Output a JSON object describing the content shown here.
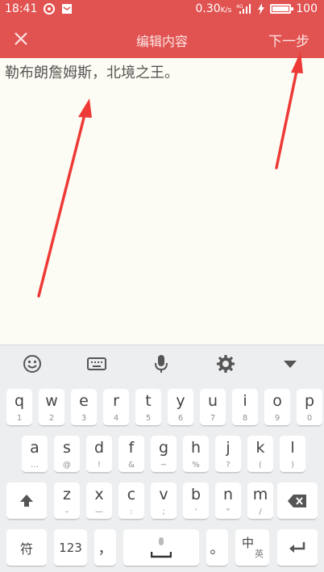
{
  "status_bar": {
    "time": "18:41",
    "network_speed": "0.30",
    "network_unit": "K/s",
    "signal_label": "4G",
    "battery": "100",
    "battery_level": 1.0
  },
  "header": {
    "close_icon": "close-icon",
    "title": "编辑内容",
    "next_label": "下一步",
    "background": "#e15351"
  },
  "editor": {
    "content": "勒布朗詹姆斯，北境之王。"
  },
  "annotations": {
    "arrow_color": "#ee3a36"
  },
  "keyboard": {
    "toolbar": [
      "emoji-icon",
      "keyboard-icon",
      "microphone-icon",
      "gear-icon",
      "collapse-icon"
    ],
    "row1": [
      {
        "main": "q",
        "sub": "1"
      },
      {
        "main": "w",
        "sub": "2"
      },
      {
        "main": "e",
        "sub": "3"
      },
      {
        "main": "r",
        "sub": "4"
      },
      {
        "main": "t",
        "sub": "5"
      },
      {
        "main": "y",
        "sub": "6"
      },
      {
        "main": "u",
        "sub": "7"
      },
      {
        "main": "i",
        "sub": "8"
      },
      {
        "main": "o",
        "sub": "9"
      },
      {
        "main": "p",
        "sub": "0"
      }
    ],
    "row2": [
      {
        "main": "a",
        "sub": "…"
      },
      {
        "main": "s",
        "sub": "@"
      },
      {
        "main": "d",
        "sub": "!"
      },
      {
        "main": "f",
        "sub": "&"
      },
      {
        "main": "g",
        "sub": "~"
      },
      {
        "main": "h",
        "sub": "%"
      },
      {
        "main": "j",
        "sub": "?"
      },
      {
        "main": "k",
        "sub": "("
      },
      {
        "main": "l",
        "sub": ")"
      }
    ],
    "row3": [
      {
        "main": "z",
        "sub": "–"
      },
      {
        "main": "x",
        "sub": "—"
      },
      {
        "main": "c",
        "sub": ":"
      },
      {
        "main": "v",
        "sub": ";"
      },
      {
        "main": "b",
        "sub": "'"
      },
      {
        "main": "n",
        "sub": "\""
      },
      {
        "main": "m",
        "sub": "/"
      }
    ],
    "symbol_key": "符",
    "num_key": "123",
    "comma_key": "，",
    "period_key": "。",
    "lang_key_main": "中",
    "lang_key_sub": "英"
  }
}
